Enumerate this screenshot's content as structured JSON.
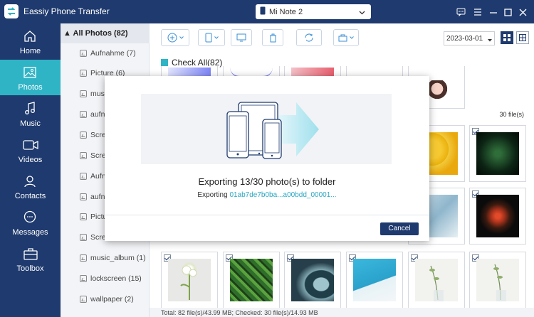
{
  "app": {
    "title": "Eassiy Phone Transfer"
  },
  "device": {
    "name": "Mi Note 2"
  },
  "nav": [
    {
      "label": "Home",
      "icon": "home-icon"
    },
    {
      "label": "Photos",
      "icon": "photos-icon"
    },
    {
      "label": "Music",
      "icon": "music-icon"
    },
    {
      "label": "Videos",
      "icon": "videos-icon"
    },
    {
      "label": "Contacts",
      "icon": "contacts-icon"
    },
    {
      "label": "Messages",
      "icon": "messages-icon"
    },
    {
      "label": "Toolbox",
      "icon": "toolbox-icon"
    }
  ],
  "albums": {
    "all_label": "All Photos (82)",
    "items": [
      {
        "label": "Aufnahme (7)"
      },
      {
        "label": "Picture (6)"
      },
      {
        "label": "music"
      },
      {
        "label": "aufna"
      },
      {
        "label": "Scree"
      },
      {
        "label": "Scree"
      },
      {
        "label": "Aufna"
      },
      {
        "label": "aufna"
      },
      {
        "label": "Pictur"
      },
      {
        "label": "Scree"
      },
      {
        "label": "music_album (1)"
      },
      {
        "label": "lockscreen (15)"
      },
      {
        "label": "wallpaper (2)"
      }
    ]
  },
  "toolbar": {
    "date": "2023-03-01"
  },
  "content": {
    "check_all": "Check All(82)",
    "group_count": "30 file(s)",
    "status": "Total: 82 file(s)/43.99 MB; Checked: 30 file(s)/14.93 MB"
  },
  "modal": {
    "title": "Exporting 13/30 photo(s) to folder",
    "sub_prefix": "Exporting",
    "filename": "01ab7de7b0ba...a00bdd_00001...",
    "cancel_label": "Cancel"
  },
  "colors": {
    "navy": "#1f3a6e",
    "accent": "#2fb4c6"
  }
}
